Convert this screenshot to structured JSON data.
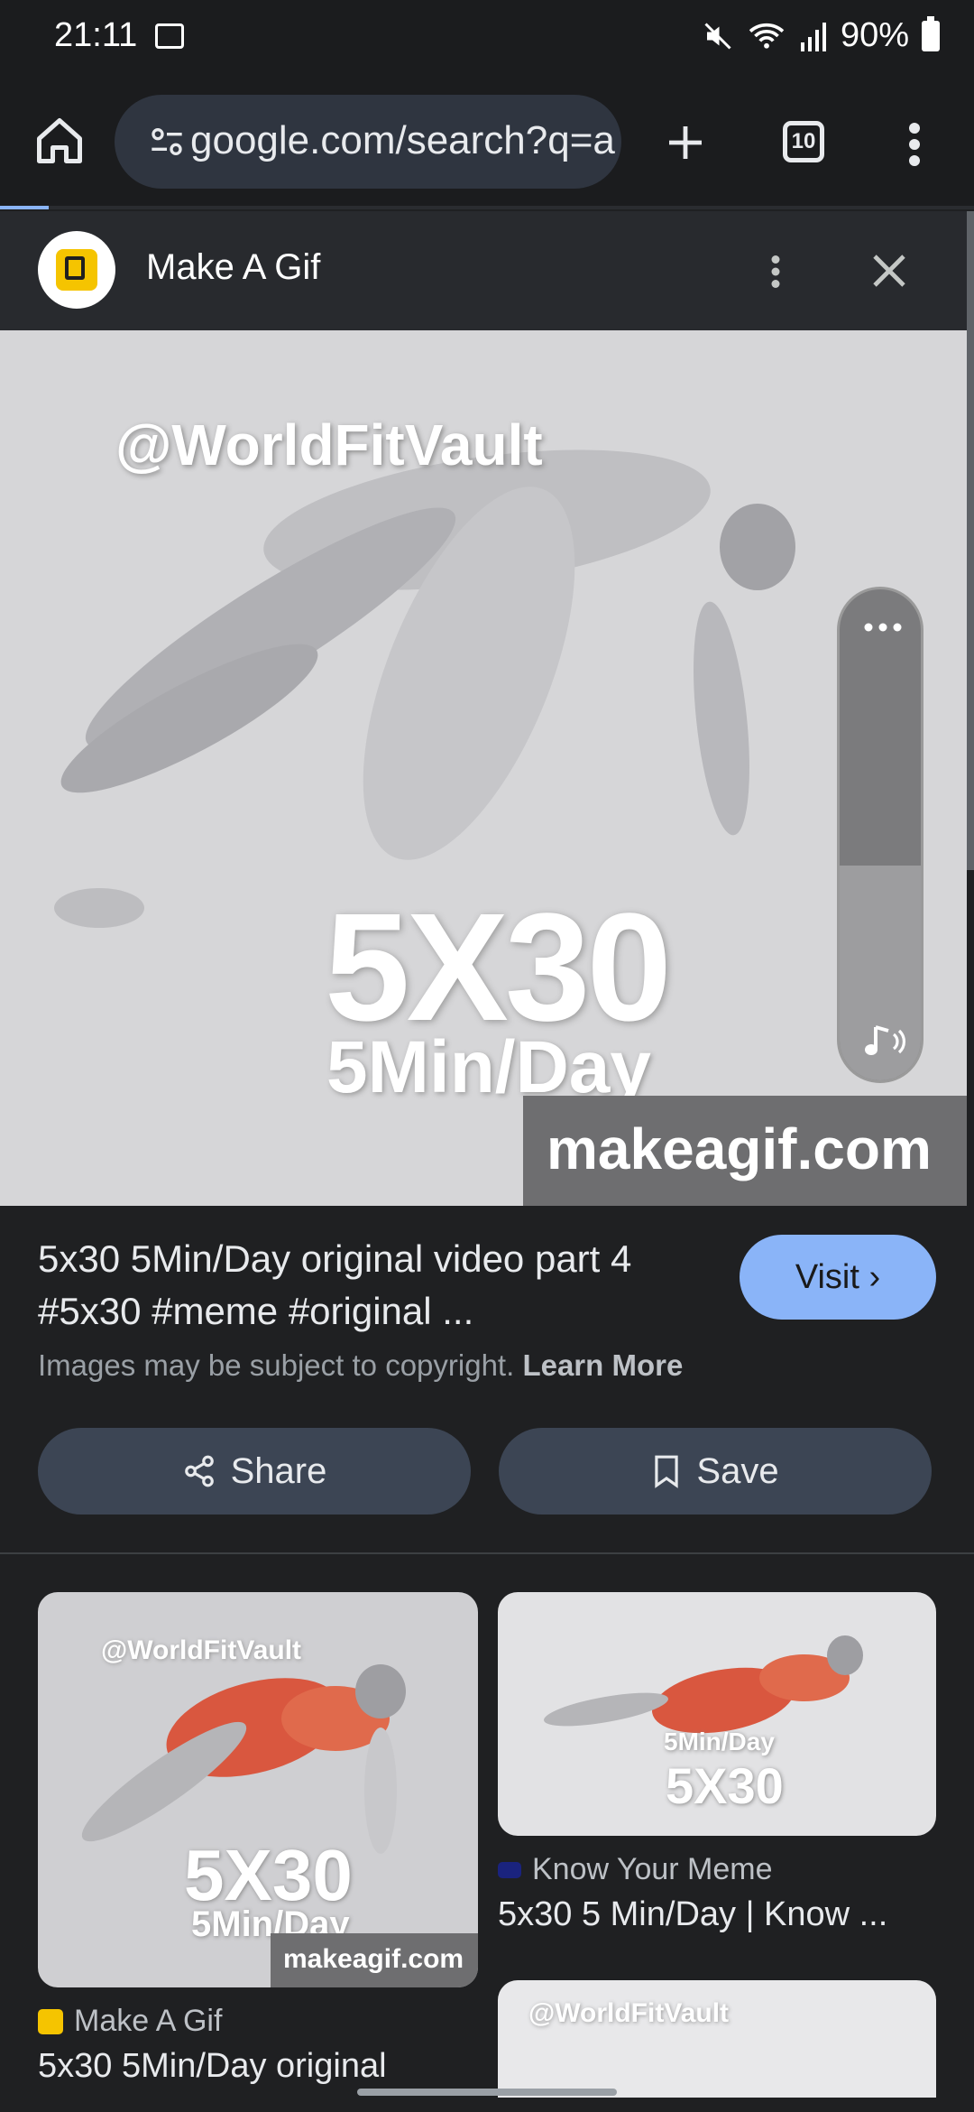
{
  "status_bar": {
    "time": "21:11",
    "battery": "90%"
  },
  "browser": {
    "url": "google.com/search?q=a",
    "tab_count": "10"
  },
  "panel": {
    "site_name": "Make A Gif"
  },
  "hero": {
    "watermark": "@WorldFitVault",
    "big_text": "5X30",
    "sub_text": "5Min/Day",
    "footer": "makeagif.com"
  },
  "result": {
    "title": "5x30 5Min/Day original video part 4 #5x30 #meme #original ...",
    "visit_label": "Visit",
    "copyright_text": "Images may be subject to copyright.",
    "learn_more": "Learn More",
    "share_label": "Share",
    "save_label": "Save"
  },
  "related": [
    {
      "watermark": "@WorldFitVault",
      "big": "5X30",
      "sub": "5Min/Day",
      "footer": "makeagif.com",
      "source": "Make A Gif",
      "caption": "5x30 5Min/Day original"
    },
    {
      "big": "5X30",
      "sub": "5Min/Day",
      "source": "Know Your Meme",
      "caption": "5x30 5 Min/Day | Know ..."
    },
    {
      "watermark": "@WorldFitVault"
    }
  ],
  "colors": {
    "accent": "#8ab4f8",
    "background": "#1f2022",
    "button": "#3c4554"
  }
}
